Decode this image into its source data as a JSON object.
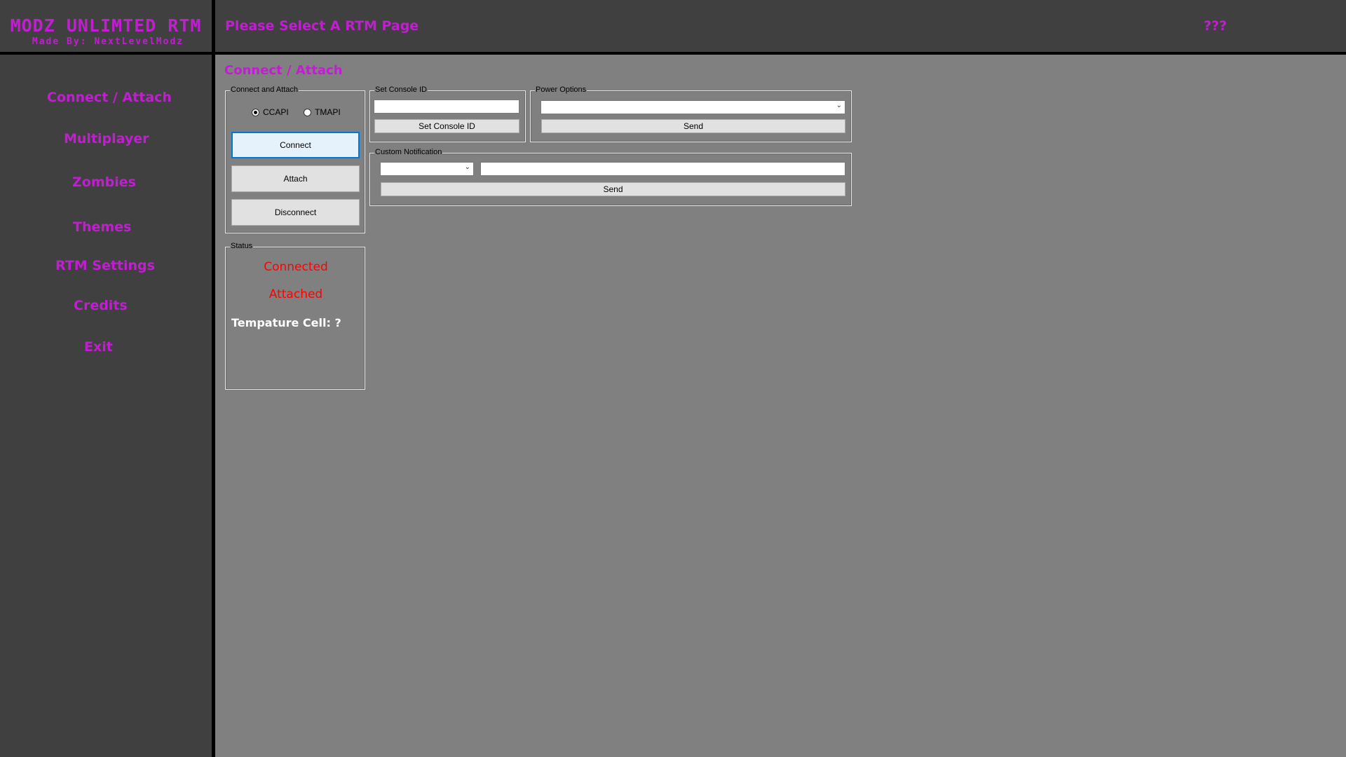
{
  "app": {
    "logo_title": "MODZ UNLIMTED RTM",
    "logo_subtitle": "Made By: NextLevelModz"
  },
  "sidebar": {
    "items": [
      {
        "label": "Connect / Attach"
      },
      {
        "label": "Multiplayer"
      },
      {
        "label": "Zombies"
      },
      {
        "label": "Themes"
      },
      {
        "label": "RTM Settings"
      },
      {
        "label": "Credits"
      },
      {
        "label": "Exit"
      }
    ]
  },
  "header": {
    "title": "Please Select A RTM Page",
    "unknown": "???"
  },
  "main": {
    "section_title": "Connect / Attach",
    "connect_group": {
      "legend": "Connect and Attach",
      "radio_ccapi": "CCAPI",
      "radio_tmapi": "TMAPI",
      "selected_api": "CCAPI",
      "connect_label": "Connect",
      "attach_label": "Attach",
      "disconnect_label": "Disconnect"
    },
    "status_group": {
      "legend": "Status",
      "connected": "Connected",
      "attached": "Attached",
      "temperature": "Tempature Cell: ?"
    },
    "console_id_group": {
      "legend": "Set Console ID",
      "input_value": "",
      "button_label": "Set Console ID"
    },
    "power_group": {
      "legend": "Power Options",
      "selected": "",
      "send_label": "Send"
    },
    "notification_group": {
      "legend": "Custom Notification",
      "icon_selected": "",
      "message_value": "",
      "send_label": "Send"
    }
  },
  "colors": {
    "accent": "#c21ed1",
    "status_red": "#ff0000",
    "panel_dark": "#404040",
    "background": "#808080"
  }
}
